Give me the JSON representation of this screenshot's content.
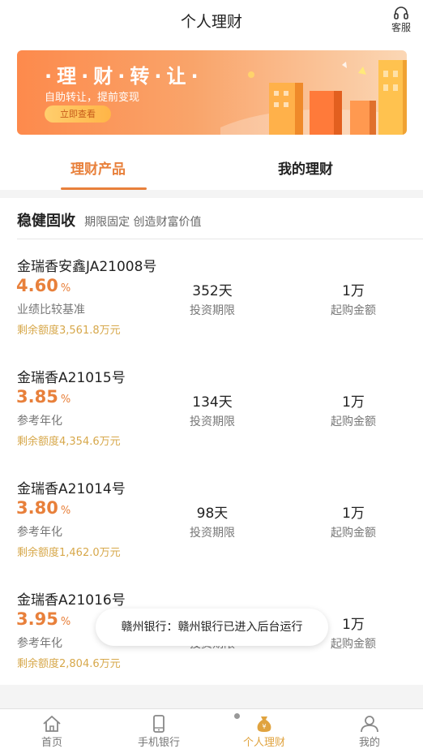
{
  "header": {
    "title": "个人理财",
    "service_label": "客服"
  },
  "banner": {
    "title": "·理·财·转·让·",
    "subtitle": "自助转让，提前变现",
    "button_label": "立即查看"
  },
  "tabs": [
    {
      "label": "理财产品",
      "active": true
    },
    {
      "label": "我的理财",
      "active": false
    }
  ],
  "section": {
    "title": "稳健固收",
    "subtitle": "期限固定 创造财富价值"
  },
  "products": [
    {
      "name": "金瑞香安鑫JA21008号",
      "rate": "4.60",
      "rate_unit": "%",
      "rate_label": "业绩比较基准",
      "remaining": "剩余额度3,561.8万元",
      "term": "352天",
      "term_label": "投资期限",
      "min": "1万",
      "min_label": "起购金额"
    },
    {
      "name": "金瑞香A21015号",
      "rate": "3.85",
      "rate_unit": "%",
      "rate_label": "参考年化",
      "remaining": "剩余额度4,354.6万元",
      "term": "134天",
      "term_label": "投资期限",
      "min": "1万",
      "min_label": "起购金额"
    },
    {
      "name": "金瑞香A21014号",
      "rate": "3.80",
      "rate_unit": "%",
      "rate_label": "参考年化",
      "remaining": "剩余额度1,462.0万元",
      "term": "98天",
      "term_label": "投资期限",
      "min": "1万",
      "min_label": "起购金额"
    },
    {
      "name": "金瑞香A21016号",
      "rate": "3.95",
      "rate_unit": "%",
      "rate_label": "参考年化",
      "remaining": "剩余额度2,804.6万元",
      "term": "",
      "term_label": "投资期限",
      "min": "1万",
      "min_label": "起购金额"
    }
  ],
  "toast": {
    "text": "赣州银行：赣州银行已进入后台运行"
  },
  "tabbar": [
    {
      "label": "首页",
      "icon": "home-icon",
      "active": false
    },
    {
      "label": "手机银行",
      "icon": "phone-icon",
      "active": false
    },
    {
      "label": "个人理财",
      "icon": "money-bag-icon",
      "active": true
    },
    {
      "label": "我的",
      "icon": "user-icon",
      "active": false
    }
  ],
  "colors": {
    "accent": "#e8803b",
    "remaining": "#d7a84b",
    "tab_active": "#e0a33f"
  }
}
